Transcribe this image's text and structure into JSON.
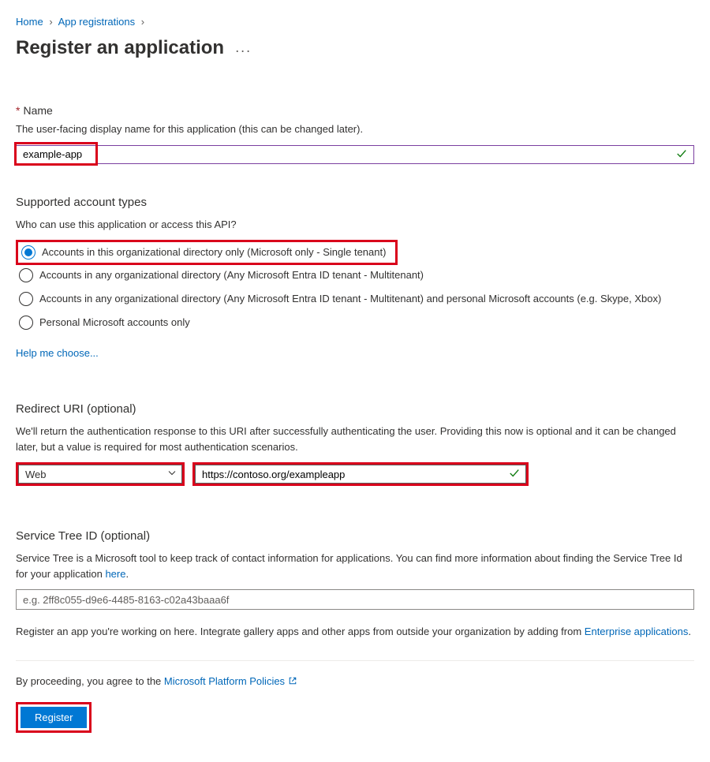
{
  "breadcrumb": {
    "items": [
      "Home",
      "App registrations"
    ]
  },
  "page": {
    "title": "Register an application"
  },
  "name": {
    "label": "Name",
    "desc": "The user-facing display name for this application (this can be changed later).",
    "value": "example-app"
  },
  "accountTypes": {
    "heading": "Supported account types",
    "question": "Who can use this application or access this API?",
    "options": [
      "Accounts in this organizational directory only (Microsoft only - Single tenant)",
      "Accounts in any organizational directory (Any Microsoft Entra ID tenant - Multitenant)",
      "Accounts in any organizational directory (Any Microsoft Entra ID tenant - Multitenant) and personal Microsoft accounts (e.g. Skype, Xbox)",
      "Personal Microsoft accounts only"
    ],
    "help": "Help me choose..."
  },
  "redirect": {
    "heading": "Redirect URI (optional)",
    "desc": "We'll return the authentication response to this URI after successfully authenticating the user. Providing this now is optional and it can be changed later, but a value is required for most authentication scenarios.",
    "platform": "Web",
    "uri": "https://contoso.org/exampleapp"
  },
  "serviceTree": {
    "heading": "Service Tree ID (optional)",
    "desc_pre": "Service Tree is a Microsoft tool to keep track of contact information for applications. You can find more information about finding the Service Tree Id for your application ",
    "desc_link": "here",
    "desc_post": ".",
    "placeholder": "e.g. 2ff8c055-d9e6-4485-8163-c02a43baaa6f"
  },
  "footer": {
    "note_pre": "Register an app you're working on here. Integrate gallery apps and other apps from outside your organization by adding from ",
    "note_link": "Enterprise applications",
    "note_post": ".",
    "policies_pre": "By proceeding, you agree to the ",
    "policies_link": "Microsoft Platform Policies",
    "register": "Register"
  }
}
